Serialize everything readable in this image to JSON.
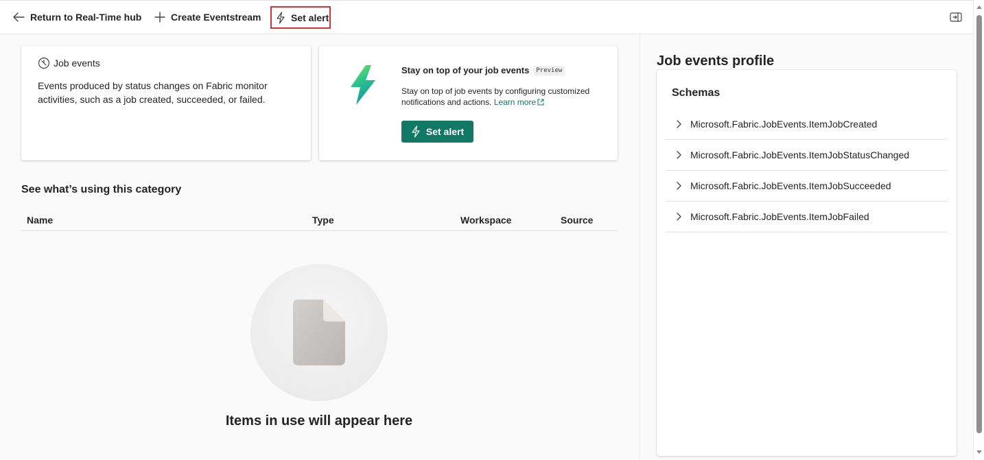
{
  "toolbar": {
    "return_label": "Return to Real-Time hub",
    "create_label": "Create Eventstream",
    "alert_label": "Set alert"
  },
  "job_card": {
    "title": "Job events",
    "description": "Events produced by status changes on Fabric monitor activities, such as a job created, succeeded, or failed."
  },
  "alert_card": {
    "title": "Stay on top of your job events",
    "badge": "Preview",
    "description": "Stay on top of job events by configuring customized notifications and actions.",
    "learn_more": "Learn more",
    "button_label": "Set alert"
  },
  "usage": {
    "heading": "See what’s using this category",
    "columns": {
      "name": "Name",
      "type": "Type",
      "workspace": "Workspace",
      "source": "Source"
    },
    "empty_text": "Items in use will appear here"
  },
  "profile": {
    "title": "Job events profile",
    "schemas_label": "Schemas",
    "schemas": [
      "Microsoft.Fabric.JobEvents.ItemJobCreated",
      "Microsoft.Fabric.JobEvents.ItemJobStatusChanged",
      "Microsoft.Fabric.JobEvents.ItemJobSucceeded",
      "Microsoft.Fabric.JobEvents.ItemJobFailed"
    ]
  },
  "colors": {
    "accent": "#117865",
    "highlight": "#d13438"
  }
}
